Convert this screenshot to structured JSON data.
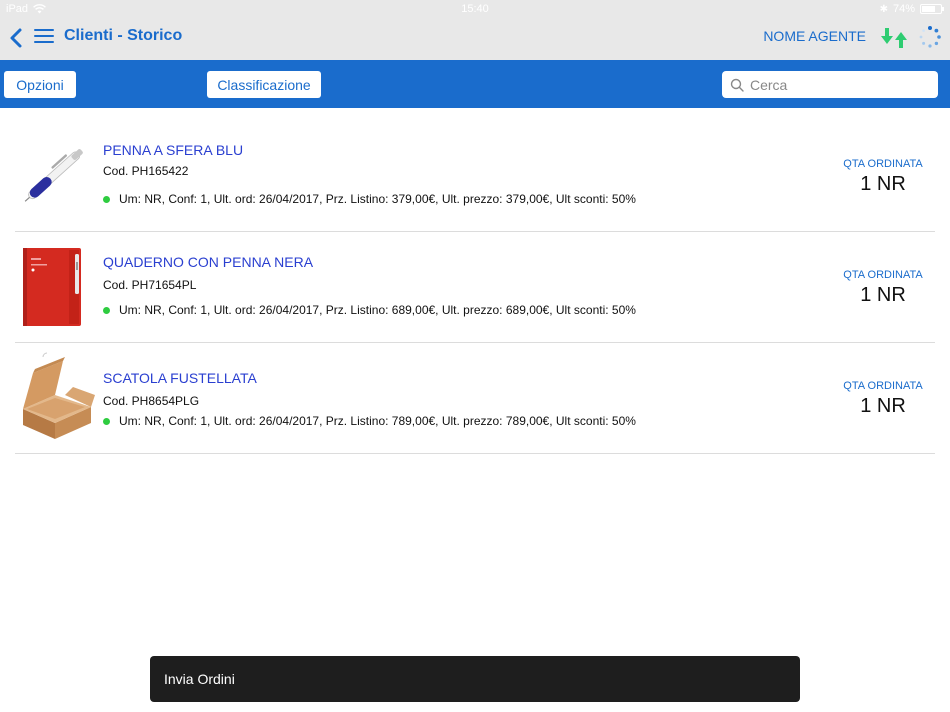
{
  "status_bar": {
    "device": "iPad",
    "time": "15:40",
    "battery": "74%",
    "battery_level": 0.74
  },
  "nav": {
    "title": "Clienti - Storico",
    "agent": "NOME AGENTE"
  },
  "toolbar": {
    "options_label": "Opzioni",
    "classification_label": "Classificazione",
    "search_placeholder": "Cerca",
    "search_value": ""
  },
  "products": [
    {
      "name": "PENNA A SFERA BLU",
      "code": "Cod. PH165422",
      "info": "Um: NR, Conf: 1, Ult. ord: 26/04/2017, Prz. Listino: 379,00€, Ult. prezzo: 379,00€, Ult sconti: 50%",
      "qta_label": "QTA ORDINATA",
      "qta": "1 NR",
      "thumb": "pen-image"
    },
    {
      "name": "QUADERNO CON PENNA NERA",
      "code": "Cod. PH71654PL",
      "info": "Um: NR, Conf: 1, Ult. ord: 26/04/2017, Prz. Listino: 689,00€, Ult. prezzo: 689,00€, Ult sconti: 50%",
      "qta_label": "QTA ORDINATA",
      "qta": "1 NR",
      "thumb": "notebook-image"
    },
    {
      "name": "SCATOLA FUSTELLATA",
      "code": "Cod. PH8654PLG",
      "info": "Um: NR, Conf: 1, Ult. ord: 26/04/2017, Prz. Listino: 789,00€, Ult. prezzo: 789,00€, Ult sconti: 50%",
      "qta_label": "QTA ORDINATA",
      "qta": "1 NR",
      "thumb": "box-image"
    }
  ],
  "toast": {
    "label": "Invia Ordini"
  },
  "colors": {
    "primary": "#1a6ccc",
    "product_name": "#2a3fd0",
    "status_dot": "#2ecc40",
    "sync": "#2ecc71"
  }
}
